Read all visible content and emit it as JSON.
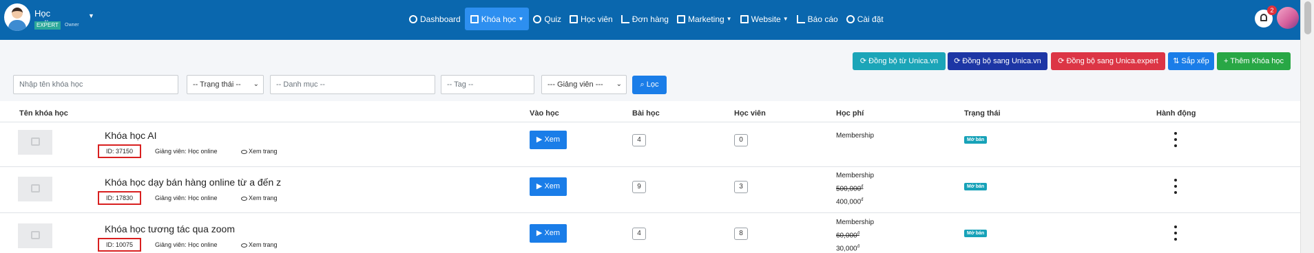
{
  "brand": {
    "name": "Học online",
    "badge": "EXPERT",
    "role": "Owner"
  },
  "nav": {
    "items": [
      {
        "label": "Dashboard",
        "icon": "dashboard-icon"
      },
      {
        "label": "Khóa học",
        "icon": "list-icon",
        "active": true,
        "dropdown": true
      },
      {
        "label": "Quiz",
        "icon": "question-circle-icon"
      },
      {
        "label": "Học viên",
        "icon": "graduation-icon"
      },
      {
        "label": "Đơn hàng",
        "icon": "cart-icon"
      },
      {
        "label": "Marketing",
        "icon": "monitor-icon",
        "dropdown": true
      },
      {
        "label": "Website",
        "icon": "desktop-icon",
        "dropdown": true
      },
      {
        "label": "Báo cáo",
        "icon": "chart-icon"
      },
      {
        "label": "Cài đặt",
        "icon": "gear-icon"
      }
    ]
  },
  "notifications": {
    "count": "2"
  },
  "actions": {
    "sync_from_unica": "Đồng bộ từ Unica.vn",
    "sync_to_unica": "Đồng bộ sang Unica.vn",
    "sync_to_expert": "Đồng bộ sang Unica.expert",
    "sort": "Sắp xếp",
    "add_course": "Thêm Khóa học"
  },
  "filters": {
    "name_placeholder": "Nhập tên khóa học",
    "status": "-- Trạng thái --",
    "category_placeholder": "-- Danh mục --",
    "tag_placeholder": "-- Tag --",
    "teacher": "--- Giảng viên ---",
    "filter_button": "Lọc"
  },
  "table": {
    "headers": {
      "name": "Tên khóa học",
      "enter": "Vào học",
      "lessons": "Bài học",
      "students": "Học viên",
      "fee": "Học phí",
      "status": "Trạng thái",
      "action": "Hành động"
    },
    "rows": [
      {
        "title": "Khóa học AI",
        "id": "ID: 37150",
        "teacher": "Giảng viên: Học online",
        "view": "Xem trang",
        "enter": "Xem",
        "lessons": "4",
        "students": "0",
        "fee_label": "Membership",
        "fee_old": "",
        "fee_new": "",
        "status": "Mở bán"
      },
      {
        "title": "Khóa học dạy bán hàng online từ a đến z",
        "id": "ID: 17830",
        "teacher": "Giảng viên: Học online",
        "view": "Xem trang",
        "enter": "Xem",
        "lessons": "9",
        "students": "3",
        "fee_label": "Membership",
        "fee_old": "500,000",
        "fee_new": "400,000",
        "status": "Mở bán"
      },
      {
        "title": "Khóa học tương tác qua zoom",
        "id": "ID: 10075",
        "teacher": "Giảng viên: Học online",
        "view": "Xem trang",
        "enter": "Xem",
        "lessons": "4",
        "students": "8",
        "fee_label": "Membership",
        "fee_old": "60,000",
        "fee_new": "30,000",
        "status": "Mở bán"
      }
    ],
    "currency_symbol": "đ"
  },
  "colors": {
    "navbar": "#0a67ae",
    "primary": "#1a7de8",
    "success": "#28a745",
    "danger": "#dc3545",
    "info": "#1ba5b8",
    "highlight_border": "#d81f1f"
  }
}
